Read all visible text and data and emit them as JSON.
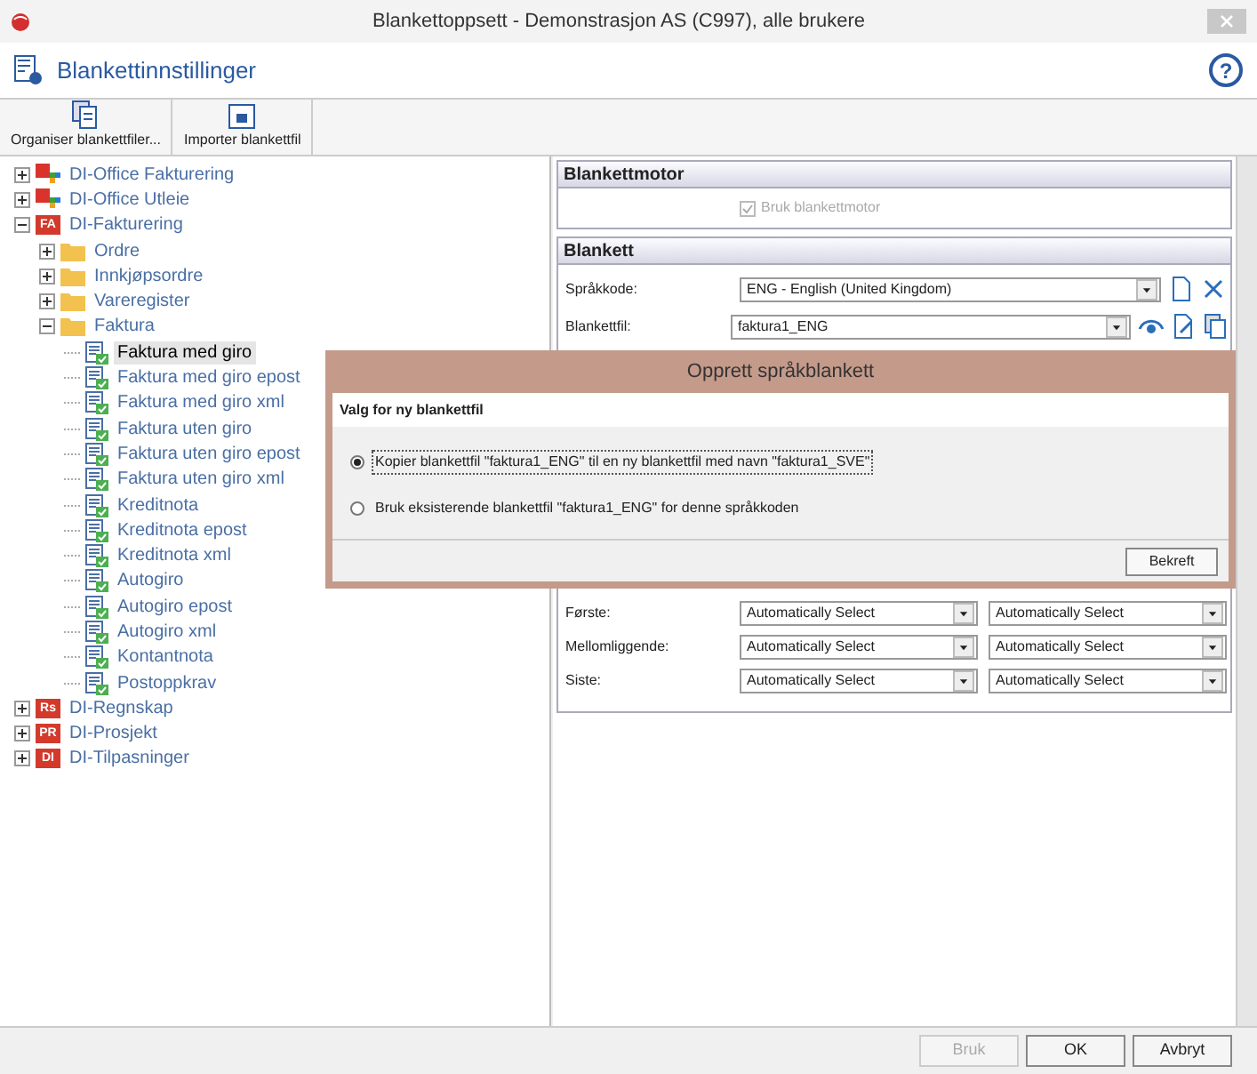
{
  "window": {
    "title": "Blankettoppsett - Demonstrasjon AS (C997), alle brukere"
  },
  "header": {
    "title": "Blankettinnstillinger",
    "help": "?"
  },
  "toolbar": [
    {
      "label": "Organiser blankettfiler...",
      "kind": "stack"
    },
    {
      "label": "Importer blankettfil",
      "kind": "import"
    }
  ],
  "tree": [
    {
      "label": "DI-Office Fakturering",
      "kind": "office",
      "expanded": false,
      "selected": false
    },
    {
      "label": "DI-Office Utleie",
      "kind": "office",
      "expanded": false,
      "selected": false
    },
    {
      "label": "DI-Fakturering",
      "kind": "badge",
      "badge": "FA",
      "expanded": true,
      "selected": false,
      "children": [
        {
          "label": "Ordre",
          "kind": "folder",
          "expanded": false,
          "selected": false
        },
        {
          "label": "Innkjøpsordre",
          "kind": "folder",
          "expanded": false,
          "selected": false
        },
        {
          "label": "Vareregister",
          "kind": "folder",
          "expanded": false,
          "selected": false
        },
        {
          "label": "Faktura",
          "kind": "folder",
          "expanded": true,
          "selected": false,
          "children": [
            {
              "label": "Faktura med giro",
              "kind": "form",
              "selected": true
            },
            {
              "label": "Faktura med giro epost",
              "kind": "form",
              "selected": false
            },
            {
              "label": "Faktura med giro xml",
              "kind": "form",
              "selected": false
            },
            {
              "label": "Faktura uten giro",
              "kind": "form",
              "selected": false
            },
            {
              "label": "Faktura uten giro epost",
              "kind": "form",
              "selected": false
            },
            {
              "label": "Faktura uten giro xml",
              "kind": "form",
              "selected": false
            },
            {
              "label": "Kreditnota",
              "kind": "form",
              "selected": false
            },
            {
              "label": "Kreditnota epost",
              "kind": "form",
              "selected": false
            },
            {
              "label": "Kreditnota xml",
              "kind": "form",
              "selected": false
            },
            {
              "label": "Autogiro",
              "kind": "form",
              "selected": false
            },
            {
              "label": "Autogiro epost",
              "kind": "form",
              "selected": false
            },
            {
              "label": "Autogiro xml",
              "kind": "form",
              "selected": false
            },
            {
              "label": "Kontantnota",
              "kind": "form",
              "selected": false
            },
            {
              "label": "Postoppkrav",
              "kind": "form",
              "selected": false
            }
          ]
        }
      ]
    },
    {
      "label": "DI-Regnskap",
      "kind": "badge",
      "badge": "Rs",
      "expanded": false,
      "selected": false
    },
    {
      "label": "DI-Prosjekt",
      "kind": "badge",
      "badge": "PR",
      "expanded": false,
      "selected": false
    },
    {
      "label": "DI-Tilpasninger",
      "kind": "badge",
      "badge": "DI",
      "expanded": false,
      "selected": false
    }
  ],
  "blankettmotor": {
    "title": "Blankettmotor",
    "checkbox": {
      "label": "Bruk blankettmotor",
      "checked": true,
      "disabled": true
    }
  },
  "blankett": {
    "title": "Blankett",
    "fields": [
      {
        "label": "Språkkode:",
        "value": "ENG - English (United Kingdom)",
        "actions": [
          {
            "kind": "new"
          },
          {
            "kind": "delete"
          }
        ]
      },
      {
        "label": "Blankettfil:",
        "value": "faktura1_ENG",
        "actions": [
          {
            "kind": "view"
          },
          {
            "kind": "edit"
          },
          {
            "kind": "copy"
          }
        ]
      }
    ],
    "rows": [
      {
        "label": "Første:",
        "values": [
          "Automatically Select",
          "Automatically Select"
        ]
      },
      {
        "label": "Mellomliggende:",
        "values": [
          "Automatically Select",
          "Automatically Select"
        ]
      },
      {
        "label": "Siste:",
        "values": [
          "Automatically Select",
          "Automatically Select"
        ]
      }
    ]
  },
  "dialog": {
    "title": "Opprett språkblankett",
    "heading": "Valg for ny blankettfil",
    "options": [
      {
        "label": "Kopier blankettfil \"faktura1_ENG\" til en ny blankettfil med navn \"faktura1_SVE\"",
        "selected": true
      },
      {
        "label": "Bruk eksisterende blankettfil \"faktura1_ENG\" for denne språkkoden",
        "selected": false
      }
    ],
    "button": "Bekreft"
  },
  "footer": [
    {
      "label": "Bruk",
      "disabled": true
    },
    {
      "label": "OK",
      "disabled": false
    },
    {
      "label": "Avbryt",
      "disabled": false
    }
  ]
}
